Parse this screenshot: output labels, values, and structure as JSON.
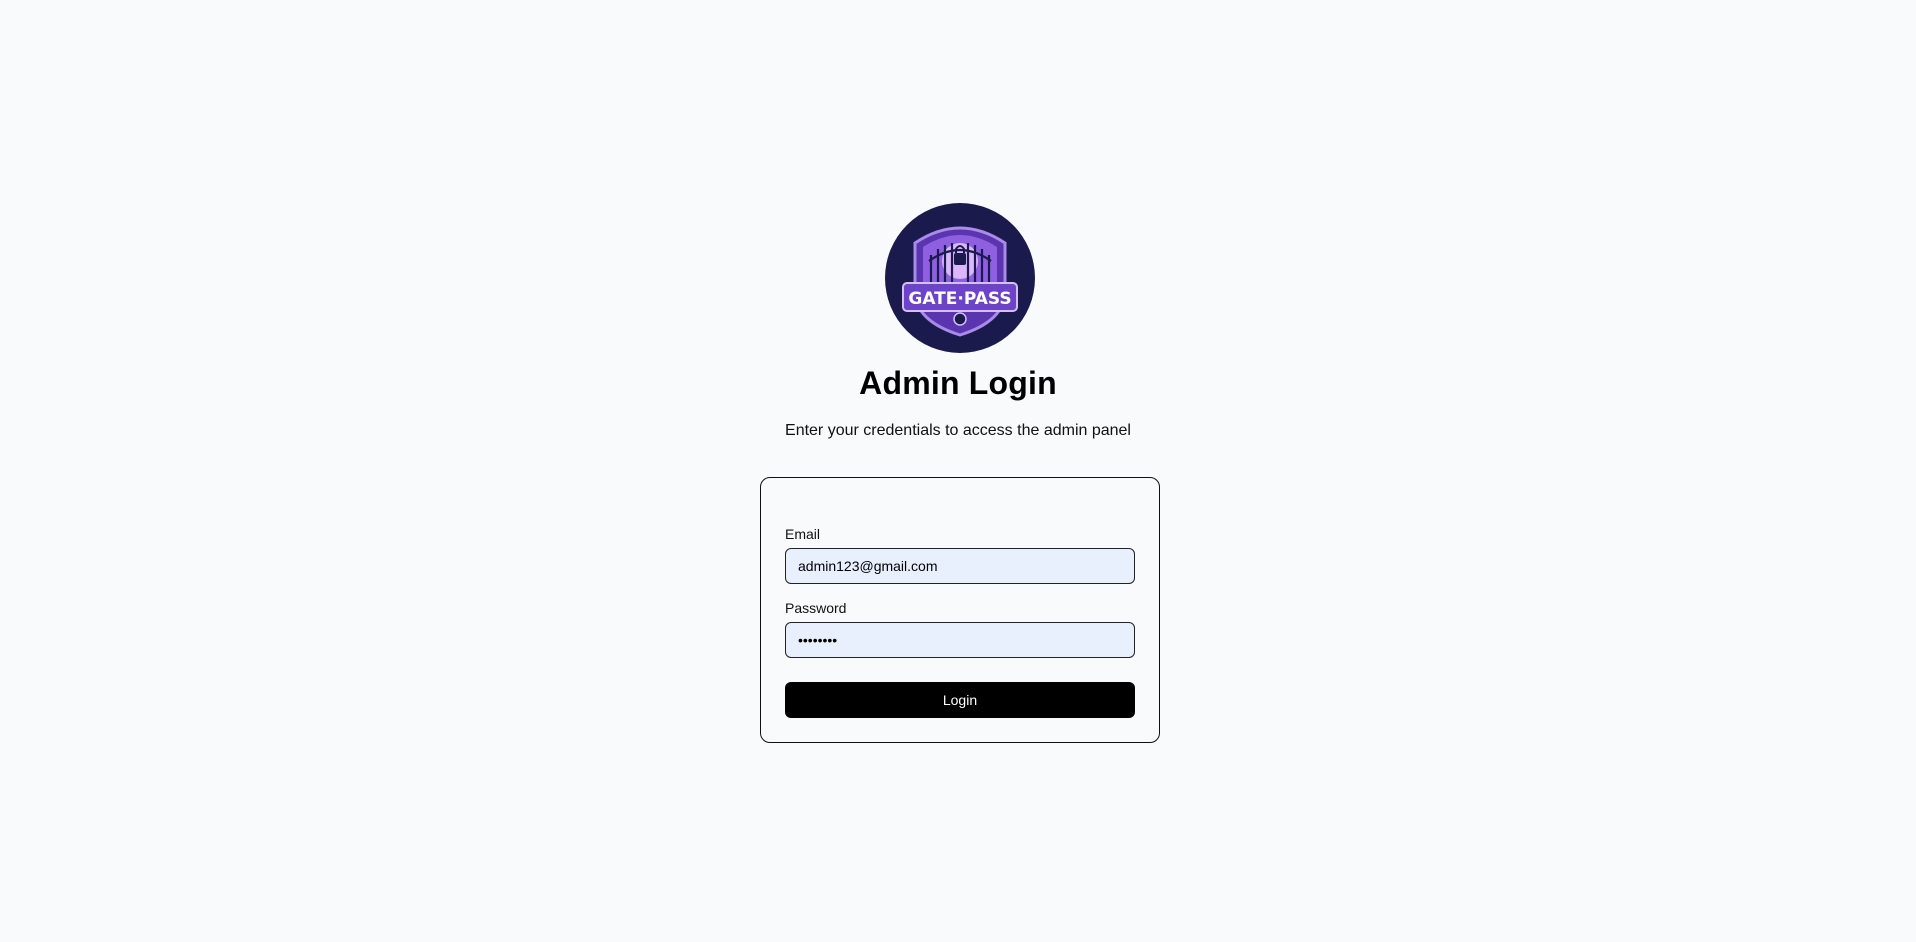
{
  "logo": {
    "text": "GATE·PASS",
    "icon": "gate-pass-logo",
    "colors": {
      "background": "#1b1a4d",
      "purple": "#7c4fd8",
      "light_purple": "#c9a8f5"
    }
  },
  "header": {
    "title": "Admin Login",
    "subtitle": "Enter your credentials to access the admin panel"
  },
  "form": {
    "email": {
      "label": "Email",
      "value": "admin123@gmail.com"
    },
    "password": {
      "label": "Password",
      "value": "adminpas"
    },
    "login_label": "Login"
  },
  "colors": {
    "page_bg": "#f8fafc",
    "input_bg": "#e8f0fe",
    "button_bg": "#000000"
  }
}
